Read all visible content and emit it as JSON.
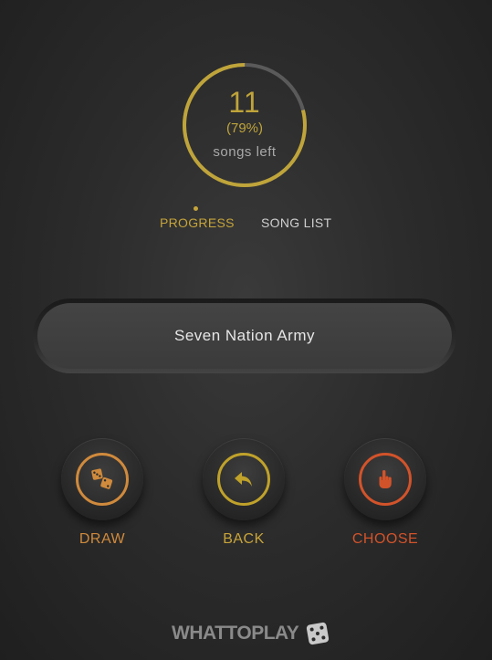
{
  "progress": {
    "count": "11",
    "percent_text": "(79%)",
    "percent_value": 0.79,
    "caption": "songs left",
    "color_active": "#bfa43a",
    "color_track": "#5a5a5a"
  },
  "tabs": [
    {
      "label": "PROGRESS",
      "active": true
    },
    {
      "label": "SONG LIST",
      "active": false
    }
  ],
  "current_song": "Seven Nation Army",
  "actions": [
    {
      "label": "DRAW",
      "icon": "dice-icon",
      "color": "#d08a3c"
    },
    {
      "label": "BACK",
      "icon": "undo-arrow-icon",
      "color": "#c0a22a"
    },
    {
      "label": "CHOOSE",
      "icon": "pointing-hand-icon",
      "color": "#d2532a"
    }
  ],
  "logo": {
    "text": "WHATTOPLAY",
    "icon": "dice-icon"
  }
}
